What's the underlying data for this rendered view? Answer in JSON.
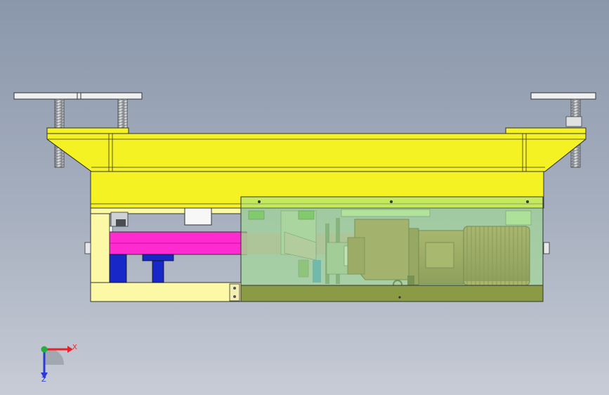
{
  "colors": {
    "background_top": "#8a97ab",
    "background_bottom": "#c7ccd6",
    "frame_yellow": "#f5f224",
    "base_yellow": "#fbf8a6",
    "beam_magenta": "#ff2ad0",
    "bracket_blue": "#1828c8",
    "housing_green": "#9ee08a",
    "housing_base": "#8a9a45",
    "motor_brown": "#a6743e",
    "bolt_gray": "#c9ccd0",
    "axis_x": "#e8222a",
    "axis_y": "#22b03a",
    "axis_z": "#2a3ad8"
  },
  "orientation_triad": {
    "x_label": "X",
    "z_label": "Z"
  }
}
